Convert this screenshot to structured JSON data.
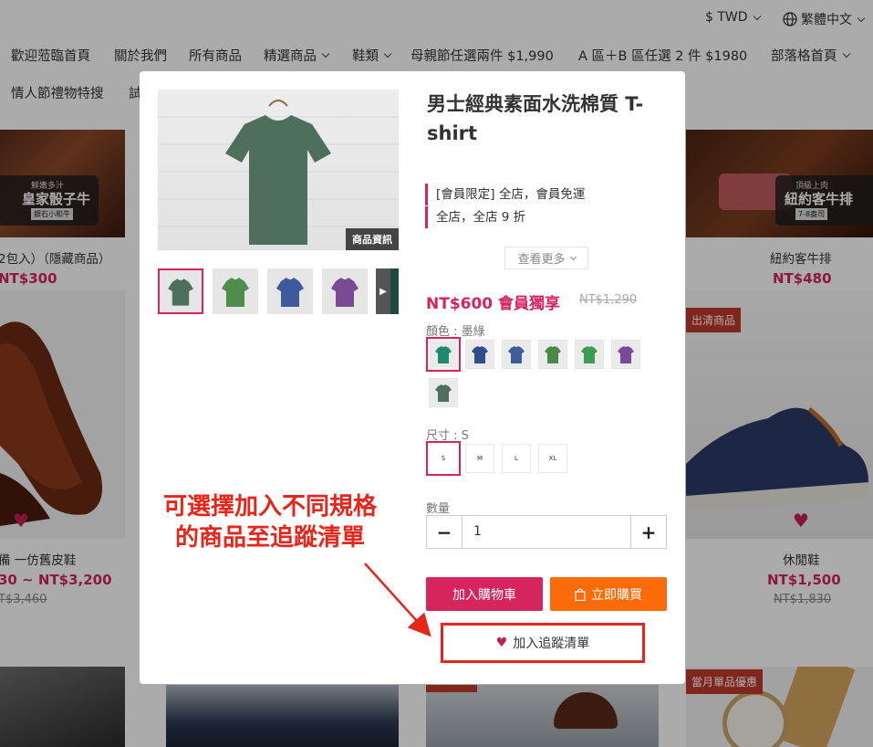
{
  "topbar": {
    "currency": "$ TWD",
    "language": "繁體中文"
  },
  "nav": {
    "row1": [
      {
        "label": "歡迎蒞臨首頁",
        "dropdown": false
      },
      {
        "label": "關於我們",
        "dropdown": false
      },
      {
        "label": "所有商品",
        "dropdown": false
      },
      {
        "label": "精選商品",
        "dropdown": true
      },
      {
        "label": "鞋類",
        "dropdown": true
      },
      {
        "label": "母親節任選兩件 $1,990",
        "dropdown": false
      },
      {
        "label": "A 區＋B 區任選 2 件 $1980",
        "dropdown": false
      },
      {
        "label": "部落格首頁",
        "dropdown": true
      }
    ],
    "row2": [
      {
        "label": "情人節禮物特搜"
      },
      {
        "label": "試"
      }
    ]
  },
  "background_products": {
    "left_banner": {
      "line1": "鮮嫩多汁",
      "line2": "皇家骰子牛",
      "line3": "銀石小和牛"
    },
    "right_banner": {
      "line1": "頂級上肉",
      "line2": "紐約客牛排",
      "line3": "7-8盎司"
    },
    "left_top": {
      "name": "2包入）（隱藏商品）",
      "price": "NT$300"
    },
    "right_top": {
      "name": "紐約客牛排",
      "price": "NT$480"
    },
    "left_mid": {
      "name": "備 一仿舊皮鞋",
      "price": "30 ~ NT$3,200",
      "old_price": "T$3,460"
    },
    "right_mid": {
      "badge": "出清商品",
      "name": "休閒鞋",
      "price": "NT$1,500",
      "old_price": "NT$1,830"
    },
    "bottom_right_badge": "當月單品優惠"
  },
  "modal": {
    "image_tag": "商品資訊",
    "title": "男士經典素面水洗棉質 T-shirt",
    "promotions": [
      "[會員限定] 全店，會員免運",
      "全店，全店 9 折"
    ],
    "see_more": "查看更多",
    "price": "NT$600 會員獨享",
    "original_price": "NT$1,290",
    "color_label": "顏色 : 墨綠",
    "size_label": "尺寸 : S",
    "sizes": [
      "S",
      "M",
      "L",
      "XL"
    ],
    "quantity_label": "數量",
    "quantity_value": "1",
    "add_to_cart": "加入購物車",
    "buy_now": "立即購買",
    "add_to_wishlist": "加入追蹤清單"
  },
  "annotation": {
    "line1": "可選擇加入不同規格",
    "line2": "的商品至追蹤清單"
  },
  "colors": {
    "accent": "#d6245f",
    "buy_now": "#fc6b0a",
    "annotation": "#e8251b"
  }
}
